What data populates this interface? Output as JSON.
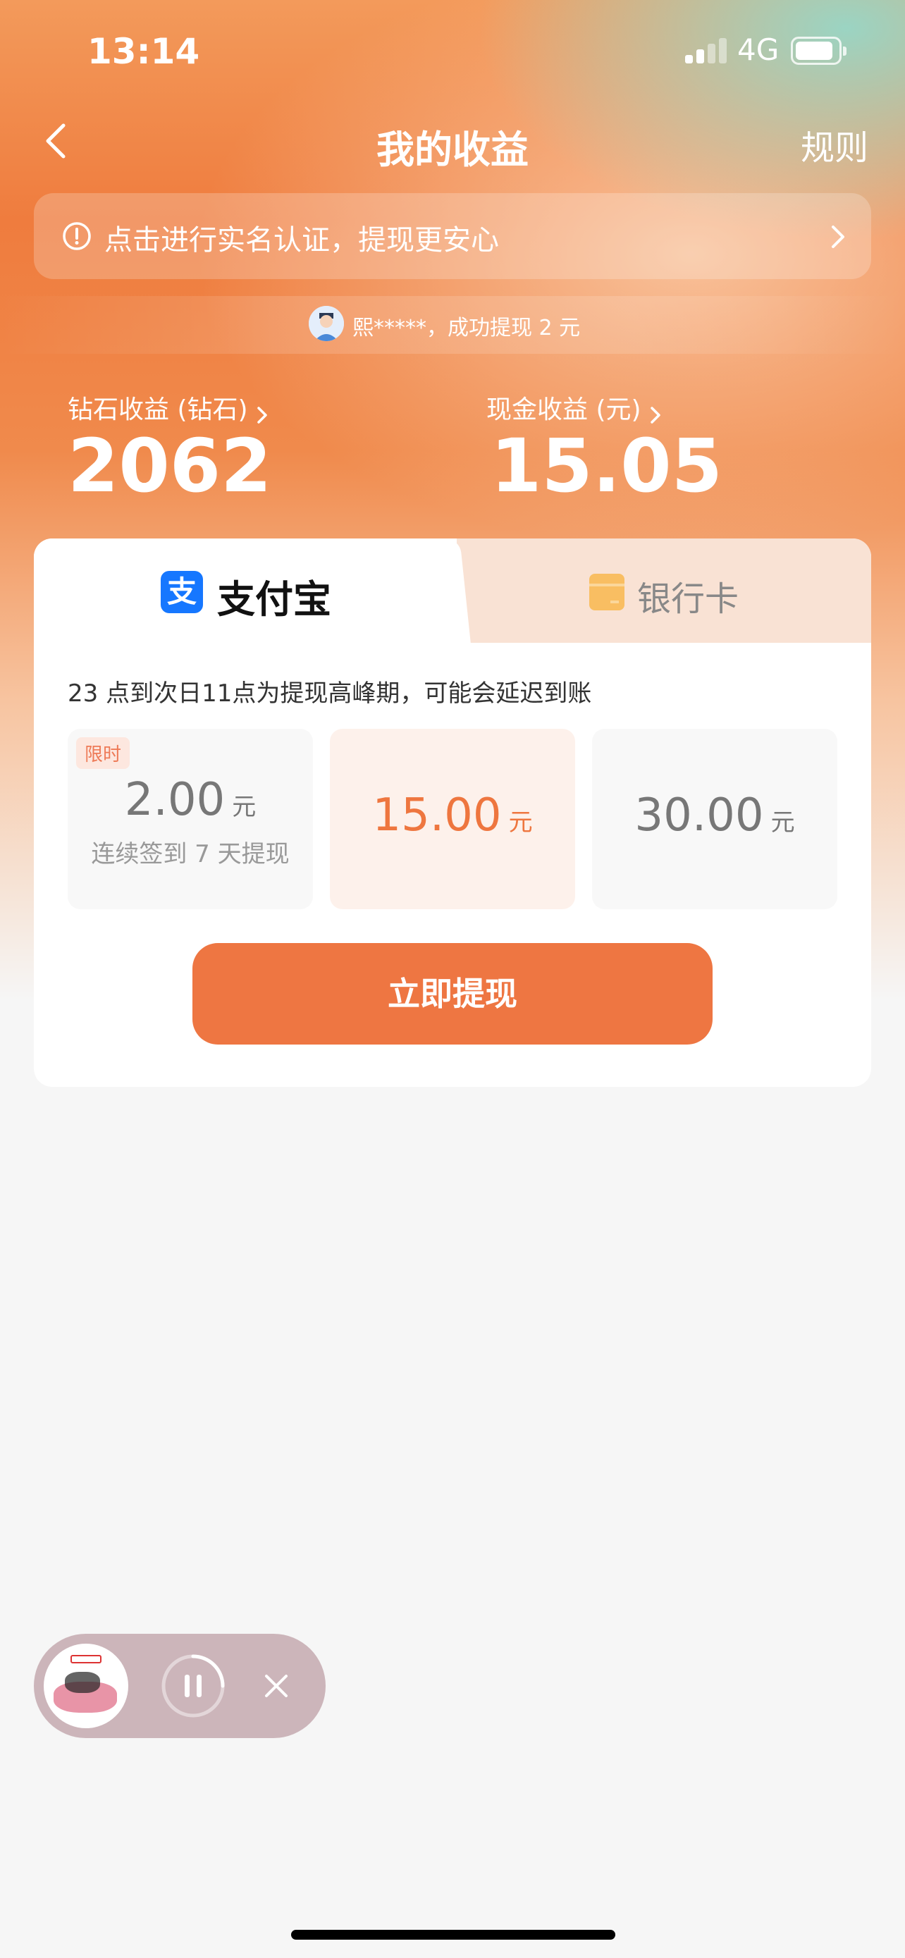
{
  "status_bar": {
    "time": "13:14",
    "network": "4G"
  },
  "header": {
    "title": "我的收益",
    "rules_label": "规则"
  },
  "verify_banner": {
    "text": "点击进行实名认证，提现更安心"
  },
  "ticker": {
    "text": "熙*****，成功提现 2 元"
  },
  "earnings": {
    "diamond": {
      "label": "钻石收益 (钻石)",
      "value": "2062"
    },
    "cash": {
      "label": "现金收益 (元)",
      "value": "15.05"
    }
  },
  "tabs": [
    {
      "label": "支付宝",
      "icon": "alipay-icon",
      "selected": true
    },
    {
      "label": "银行卡",
      "icon": "bank-card-icon",
      "selected": false
    }
  ],
  "notice": "23 点到次日11点为提现高峰期，可能会延迟到账",
  "amounts": [
    {
      "value": "2.00",
      "unit": "元",
      "badge": "限时",
      "sub": "连续签到 7 天提现",
      "selected": false
    },
    {
      "value": "15.00",
      "unit": "元",
      "selected": true
    },
    {
      "value": "30.00",
      "unit": "元",
      "selected": false
    }
  ],
  "withdraw_button": "立即提现",
  "colors": {
    "accent": "#ee7642",
    "alipay_blue": "#1677ff",
    "selected_bg": "#fdf1eb"
  }
}
